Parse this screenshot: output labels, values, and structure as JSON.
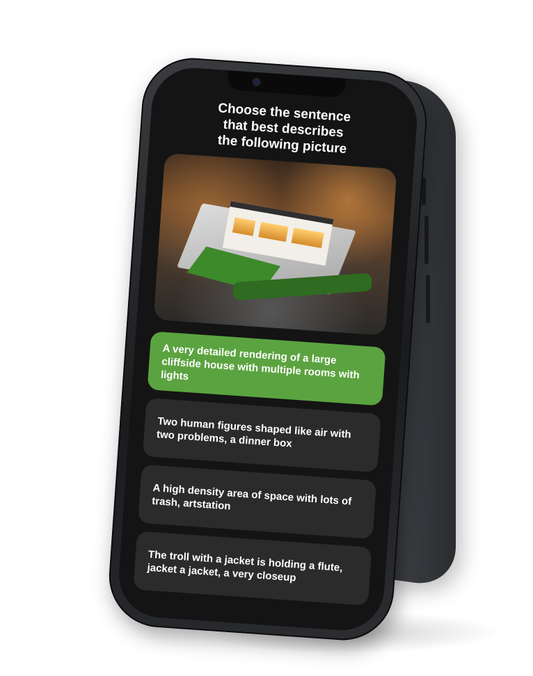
{
  "quiz": {
    "title": "Choose the sentence\nthat best describes\nthe following picture",
    "image_alt": "cliffside house rendering",
    "options": [
      {
        "label": "A very detailed rendering of a large cliffside house with multiple rooms with lights",
        "selected": true
      },
      {
        "label": "Two human figures shaped like air with two problems, a dinner box",
        "selected": false
      },
      {
        "label": "A high density area of space with lots of trash, artstation",
        "selected": false
      },
      {
        "label": "The troll with a jacket is holding a flute, jacket a jacket, a very closeup",
        "selected": false
      }
    ]
  },
  "colors": {
    "screen_bg": "#141414",
    "option_bg": "#2b2b2b",
    "selected_bg": "#5ba340",
    "text": "#ffffff"
  }
}
